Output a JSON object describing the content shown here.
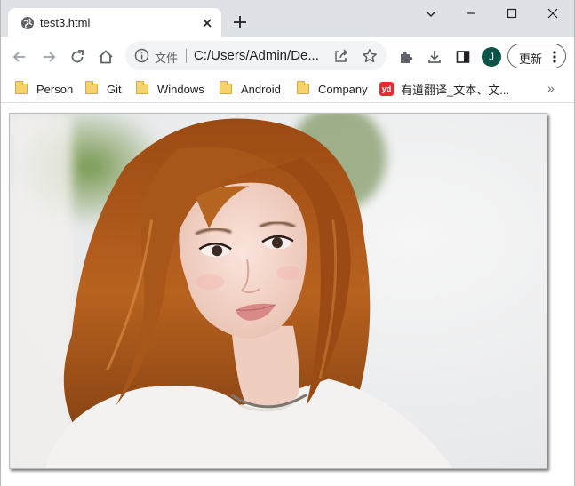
{
  "tab": {
    "title": "test3.html",
    "favicon": "globe-icon"
  },
  "toolbar": {
    "scheme_label": "文件",
    "url": "C:/Users/Admin/De...",
    "avatar_letter": "J",
    "update_label": "更新"
  },
  "bookmarks": [
    {
      "label": "Person",
      "icon": "folder-icon"
    },
    {
      "label": "Git",
      "icon": "folder-icon"
    },
    {
      "label": "Windows",
      "icon": "folder-icon"
    },
    {
      "label": "Android",
      "icon": "folder-icon"
    },
    {
      "label": "Company",
      "icon": "folder-icon"
    },
    {
      "label": "有道翻译_文本、文...",
      "icon": "youdao-icon"
    }
  ],
  "bookmarks_more": "»",
  "colors": {
    "tabstrip": "#dee1e6",
    "avatar": "#0b5346",
    "youdao": "#e52b2f"
  }
}
